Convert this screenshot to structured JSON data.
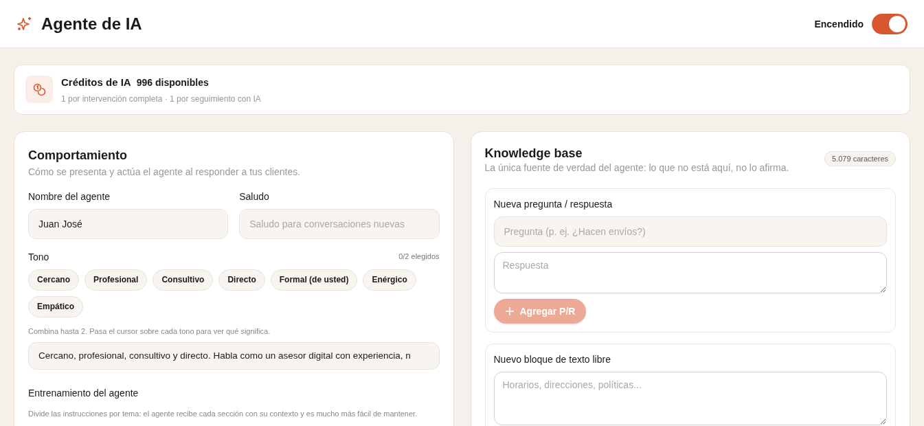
{
  "header": {
    "title": "Agente de IA",
    "toggle": {
      "label": "Encendido",
      "on": true
    }
  },
  "credits": {
    "title": "Créditos de IA",
    "available": "996 disponibles",
    "note": "1 por intervención completa · 1 por seguimiento con IA"
  },
  "behavior": {
    "title": "Comportamiento",
    "subtitle": "Cómo se presenta y actúa el agente al responder a tus clientes.",
    "fields": [
      {
        "label": "Nombre del agente",
        "value": "Juan José"
      },
      {
        "label": "Saludo",
        "placeholder": "Saludo para conversaciones nuevas"
      }
    ],
    "tone": {
      "label": "Tono",
      "count": "0/2 elegidos",
      "options": [
        {
          "label": "Cercano",
          "selected": false
        },
        {
          "label": "Profesional",
          "selected": false
        },
        {
          "label": "Consultivo",
          "selected": false
        },
        {
          "label": "Directo",
          "selected": false
        },
        {
          "label": "Formal (de usted)",
          "selected": false
        },
        {
          "label": "Enérgico",
          "selected": false
        },
        {
          "label": "Empático",
          "selected": false
        }
      ],
      "hint": "Combina hasta 2. Pasa el cursor sobre cada tono para ver qué significa.",
      "value": "Cercano, profesional, consultivo y directo. Habla como un asesor digital con experiencia, n"
    },
    "training": {
      "title": "Entrenamiento del agente",
      "hint": "Divide las instrucciones por tema: el agente recibe cada sección con su contexto y es mucho más fácil de mantener."
    }
  },
  "knowledge": {
    "title": "Knowledge base",
    "subtitle": "La única fuente de verdad del agente: lo que no está aquí, no lo afirma.",
    "count": "5.079 caracteres",
    "qa": {
      "title": "Nueva pregunta / respuesta",
      "question_placeholder": "Pregunta (p. ej. ¿Hacen envíos?)",
      "answer_placeholder": "Respuesta",
      "button": {
        "label": "Agregar P/R",
        "disabled": true
      }
    },
    "text_block": {
      "title": "Nuevo bloque de texto libre",
      "placeholder": "Horarios, direcciones, políticas..."
    }
  }
}
